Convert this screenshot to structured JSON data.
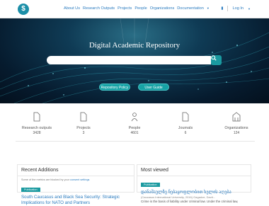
{
  "nav": {
    "items": [
      "About Us",
      "Research Outputs",
      "Projects",
      "People",
      "Organizations",
      "Documentation"
    ],
    "login": "Log In"
  },
  "hero": {
    "title": "Digital Academic Repository",
    "search_placeholder": "",
    "buttons": [
      "Repository Policy",
      "User Guide"
    ]
  },
  "stats": [
    {
      "label": "Research outputs",
      "value": "3428",
      "icon": "document-icon"
    },
    {
      "label": "Projects",
      "value": "3",
      "icon": "document-icon"
    },
    {
      "label": "People",
      "value": "4601",
      "icon": "person-icon"
    },
    {
      "label": "Journals",
      "value": "6",
      "icon": "document-icon"
    },
    {
      "label": "Organizations",
      "value": "124",
      "icon": "building-icon"
    }
  ],
  "recent": {
    "title": "Recent Additions",
    "note_prefix": "Some of the metrics are blocked by your",
    "note_link": "consent settings",
    "badge": "Publication",
    "item_title": "South Caucasus and Black Sea Security: Strategic Implications for NATO and Partners"
  },
  "most_viewed": {
    "title": "Most viewed",
    "badge": "Publication",
    "item_title": "დანაშაულზე ნებაყოფლობით ხელის აღება",
    "item_sub": "(Caucasus International University, 2016) Gagadze, Davit...",
    "item_desc": "Crime is the basis of liability under criminal law. Under the criminal law,"
  },
  "colors": {
    "accent": "#1a9aa0",
    "link": "#2a7bbf",
    "hero_dark": "#061b2e"
  }
}
